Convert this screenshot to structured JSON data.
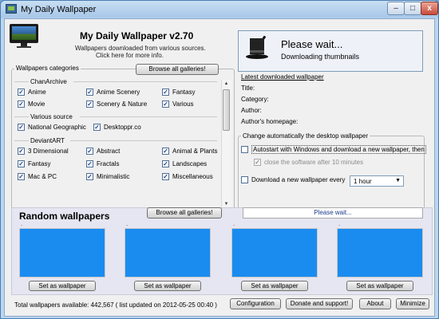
{
  "window": {
    "title": "My Daily Wallpaper"
  },
  "header": {
    "app_title": "My Daily Wallpaper v2.70",
    "subtitle_line1": "Wallpapers downloaded from various sources.",
    "subtitle_line2": "Click here for more info."
  },
  "categories": {
    "group_label": "Wallpapers categories",
    "browse_all_label": "Browse all galleries!",
    "sections": [
      {
        "title": "ChanArchive",
        "items": [
          {
            "label": "Anime",
            "checked": true
          },
          {
            "label": "Anime Scenery",
            "checked": true
          },
          {
            "label": "Fantasy",
            "checked": true
          },
          {
            "label": "Movie",
            "checked": true
          },
          {
            "label": "Scenery & Nature",
            "checked": true
          },
          {
            "label": "Various",
            "checked": true
          }
        ]
      },
      {
        "title": "Various source",
        "items": [
          {
            "label": "National Geographic",
            "checked": true
          },
          {
            "label": "Desktoppr.co",
            "checked": true
          }
        ]
      },
      {
        "title": "DeviantART",
        "items": [
          {
            "label": "3 Dimensional",
            "checked": true
          },
          {
            "label": "Abstract",
            "checked": true
          },
          {
            "label": "Animal & Plants",
            "checked": true
          },
          {
            "label": "Fantasy",
            "checked": true
          },
          {
            "label": "Fractals",
            "checked": true
          },
          {
            "label": "Landscapes",
            "checked": true
          },
          {
            "label": "Mac & PC",
            "checked": true
          },
          {
            "label": "Minimalistic",
            "checked": true
          },
          {
            "label": "Miscellaneous",
            "checked": true
          }
        ]
      }
    ]
  },
  "status_box": {
    "title": "Please wait...",
    "subtitle": "Downloading thumbnails"
  },
  "latest": {
    "link_label": "Latest downloaded wallpaper",
    "title_label": "Title:",
    "category_label": "Category:",
    "author_label": "Author:",
    "homepage_label": "Author's homepage:"
  },
  "auto_change": {
    "group_label": "Change automatically the desktop wallpaper",
    "autostart_label": "Autostart with Windows and download a new wallpaper, then",
    "autostart_checked": false,
    "close_label": "close the software after 10 minutes",
    "close_checked": true,
    "download_every_label": "Download a new wallpaper every",
    "download_every_checked": false,
    "interval_value": "1 hour"
  },
  "random": {
    "title": "Random wallpapers",
    "browse_all_label": "Browse all galleries!",
    "wait_label": "Please wait...",
    "thumbnails": [
      {
        "dot": ".",
        "button": "Set as wallpaper"
      },
      {
        "dot": ".",
        "button": "Set as wallpaper"
      },
      {
        "dot": ".",
        "button": "Set as wallpaper"
      },
      {
        "dot": ".",
        "button": "Set as wallpaper"
      }
    ],
    "thumb_color": "#1a8cf0"
  },
  "footer": {
    "status_text": "Total wallpapers available: 442,567  ( list updated on 2012-05-25 00:40 )",
    "configuration_label": "Configuration",
    "donate_label": "Donate and support!",
    "about_label": "About",
    "minimize_label": "Minimize"
  },
  "titlebar_buttons": {
    "minimize": "–",
    "maximize": "□",
    "close": "x"
  }
}
